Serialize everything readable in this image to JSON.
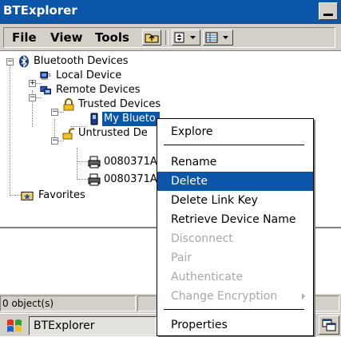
{
  "window": {
    "title": "BTExplorer"
  },
  "menubar": {
    "items": [
      "File",
      "View",
      "Tools"
    ]
  },
  "tree": {
    "root": "Bluetooth Devices",
    "local_device": "Local Device",
    "remote_devices": "Remote Devices",
    "trusted": "Trusted Devices",
    "trusted_child": "My Blueto",
    "untrusted": "Untrusted De",
    "untrusted_child_1": "0080371A",
    "untrusted_child_2": "0080371A",
    "favorites": "Favorites"
  },
  "context_menu": {
    "items": [
      {
        "label": "Explore",
        "state": "enabled"
      },
      {
        "label": "Rename",
        "state": "enabled"
      },
      {
        "label": "Delete",
        "state": "highlighted"
      },
      {
        "label": "Delete Link Key",
        "state": "enabled"
      },
      {
        "label": "Retrieve Device Name",
        "state": "enabled"
      },
      {
        "label": "Disconnect",
        "state": "disabled"
      },
      {
        "label": "Pair",
        "state": "disabled"
      },
      {
        "label": "Authenticate",
        "state": "disabled"
      },
      {
        "label": "Change Encryption",
        "state": "disabled"
      },
      {
        "label": "Properties",
        "state": "enabled"
      }
    ]
  },
  "status": {
    "objects": "0 object(s)"
  },
  "taskbar": {
    "app_label": "BTExplorer"
  },
  "colors": {
    "titlebar": "#0b56a8",
    "selection": "#0b56a8",
    "chrome": "#d4d0c8"
  }
}
